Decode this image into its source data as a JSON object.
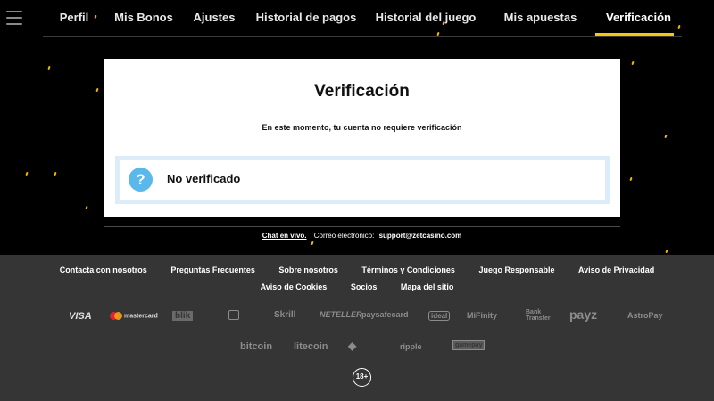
{
  "nav": {
    "tabs": [
      {
        "label": "Perfil"
      },
      {
        "label": "Mis Bonos"
      },
      {
        "label": "Ajustes"
      },
      {
        "label": "Historial de pagos"
      },
      {
        "label": "Historial del juego"
      },
      {
        "label": "Mis apuestas"
      },
      {
        "label": "Verificación"
      }
    ],
    "active_tab": "Verificación",
    "accent_color": "#f5c518"
  },
  "verification": {
    "title": "Verificación",
    "message": "En este momento, tu cuenta no requiere verificación",
    "status_icon": "question-icon",
    "status_label": "No verificado"
  },
  "contact": {
    "chat_label": "Chat en vivo.",
    "email_label": "Correo electrónico:",
    "email": "support@zetcasino.com"
  },
  "footer": {
    "links_row1": [
      "Contacta con nosotros",
      "Preguntas Frecuentes",
      "Sobre nosotros",
      "Términos y Condiciones",
      "Juego Responsable",
      "Aviso de Privacidad"
    ],
    "links_row2": [
      "Aviso de Cookies",
      "Socios",
      "Mapa del sitio"
    ],
    "payment_logos": [
      "VISA",
      "mastercard",
      "blik",
      "Skrill",
      "NETELLER",
      "paysafecard",
      "ideal",
      "MiFinity",
      "Bank Transfer",
      "payz",
      "AstroPay"
    ],
    "crypto_logos": [
      "bitcoin",
      "litecoin",
      "ethereum",
      "ripple",
      "gamepay"
    ],
    "age_badge": "18+"
  }
}
